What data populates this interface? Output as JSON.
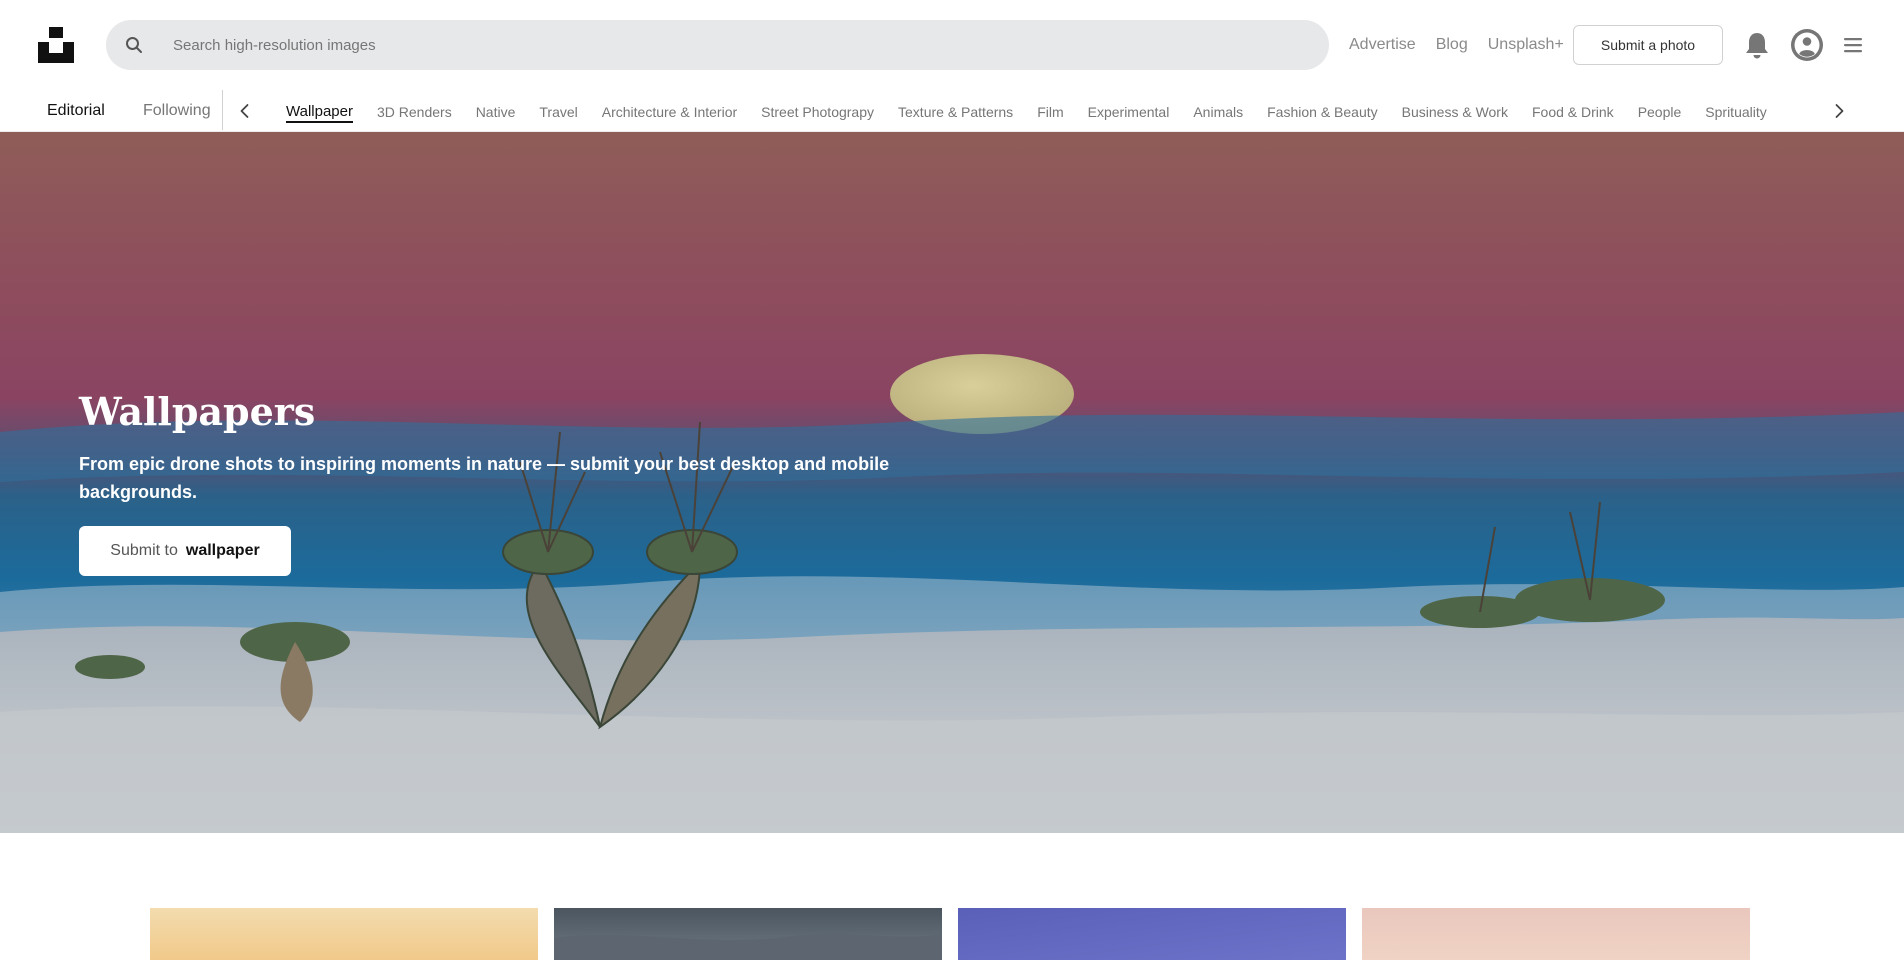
{
  "brand": {
    "logo_icon": "unsplash-logo-icon"
  },
  "search": {
    "placeholder": "Search high-resolution images",
    "icon": "search-icon"
  },
  "header_links": [
    "Advertise",
    "Blog",
    "Unsplash+"
  ],
  "header": {
    "submit_label": "Submit a photo",
    "bell_icon": "bell-icon",
    "avatar_icon": "avatar-icon",
    "menu_icon": "menu-icon"
  },
  "feed_tabs": {
    "editorial": "Editorial",
    "following": "Following"
  },
  "topics": [
    "Wallpaper",
    "3D Renders",
    "Native",
    "Travel",
    "Architecture & Interior",
    "Street Photograpy",
    "Texture & Patterns",
    "Film",
    "Experimental",
    "Animals",
    "Fashion & Beauty",
    "Business & Work",
    "Food & Drink",
    "People",
    "Sprituality"
  ],
  "active_topic": "Wallpaper",
  "hero": {
    "title": "Wallpapers",
    "subtitle": "From epic drone shots to inspiring moments in nature — submit your best desktop and mobile backgrounds.",
    "button_prefix": "Submit to",
    "button_keyword": "wallpaper"
  },
  "colors": {
    "accent": "#111111",
    "muted_text": "#767676",
    "search_bg": "#e7e8ea",
    "sky_top": "#8f5a55",
    "sky_mid": "#8c4460",
    "horizon_blue": "#1f6a9a",
    "sand": "#b7bfc7"
  }
}
